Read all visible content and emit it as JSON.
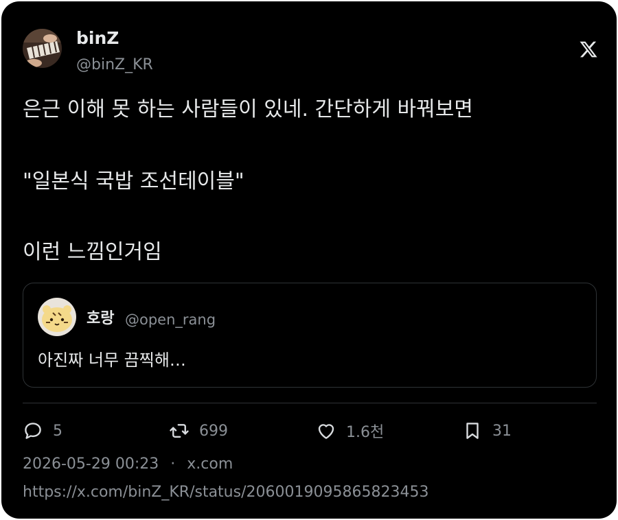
{
  "author": {
    "name": "binZ",
    "handle": "@binZ_KR"
  },
  "brand_icon": "x-logo-icon",
  "tweet": {
    "line1": "은근 이해 못 하는 사람들이 있네. 간단하게 바꿔보면",
    "line2": "\"일본식 국밥 조선테이블\"",
    "line3": "이런 느낌인거임"
  },
  "quote": {
    "name": "호랑",
    "handle": "@open_rang",
    "text": "아진짜 너무 끔찍해…"
  },
  "actions": {
    "replies": "5",
    "retweets": "699",
    "likes": "1.6천",
    "bookmarks": "31"
  },
  "meta": {
    "timestamp": "2026-05-29 00:23",
    "separator": "·",
    "source": "x.com",
    "url": "https://x.com/binZ_KR/status/2060019095865823453"
  },
  "colors": {
    "background": "#000000",
    "text": "#e7e9ea",
    "secondary": "#8b9096",
    "border": "#2f3336"
  }
}
